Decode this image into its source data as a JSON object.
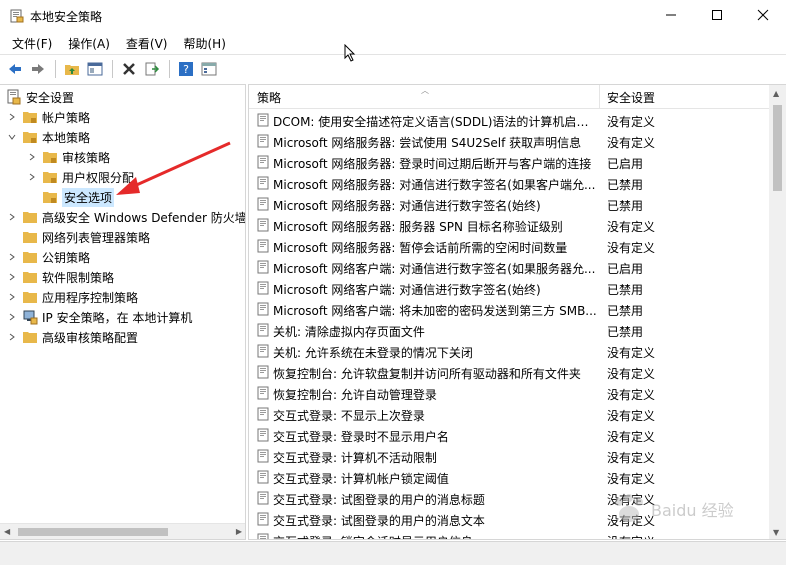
{
  "window": {
    "title": "本地安全策略"
  },
  "menu": [
    {
      "label": "文件",
      "key": "(F)"
    },
    {
      "label": "操作",
      "key": "(A)"
    },
    {
      "label": "查看",
      "key": "(V)"
    },
    {
      "label": "帮助",
      "key": "(H)"
    }
  ],
  "tree": {
    "root": "安全设置",
    "items": [
      {
        "label": "帐户策略"
      },
      {
        "label": "本地策略"
      },
      {
        "label": "审核策略"
      },
      {
        "label": "用户权限分配"
      },
      {
        "label": "安全选项"
      },
      {
        "label": "高级安全 Windows Defender 防火墙"
      },
      {
        "label": "网络列表管理器策略"
      },
      {
        "label": "公钥策略"
      },
      {
        "label": "软件限制策略"
      },
      {
        "label": "应用程序控制策略"
      },
      {
        "label": "IP 安全策略，在 本地计算机"
      },
      {
        "label": "高级审核策略配置"
      }
    ]
  },
  "list": {
    "columns": {
      "policy": "策略",
      "setting": "安全设置"
    },
    "rows": [
      {
        "policy": "DCOM: 使用安全描述符定义语言(SDDL)语法的计算机启动...",
        "setting": "没有定义"
      },
      {
        "policy": "Microsoft 网络服务器: 尝试使用 S4U2Self 获取声明信息",
        "setting": "没有定义"
      },
      {
        "policy": "Microsoft 网络服务器: 登录时间过期后断开与客户端的连接",
        "setting": "已启用"
      },
      {
        "policy": "Microsoft 网络服务器: 对通信进行数字签名(如果客户端允...",
        "setting": "已禁用"
      },
      {
        "policy": "Microsoft 网络服务器: 对通信进行数字签名(始终)",
        "setting": "已禁用"
      },
      {
        "policy": "Microsoft 网络服务器: 服务器 SPN 目标名称验证级别",
        "setting": "没有定义"
      },
      {
        "policy": "Microsoft 网络服务器: 暂停会话前所需的空闲时间数量",
        "setting": "没有定义"
      },
      {
        "policy": "Microsoft 网络客户端: 对通信进行数字签名(如果服务器允...",
        "setting": "已启用"
      },
      {
        "policy": "Microsoft 网络客户端: 对通信进行数字签名(始终)",
        "setting": "已禁用"
      },
      {
        "policy": "Microsoft 网络客户端: 将未加密的密码发送到第三方 SMB...",
        "setting": "已禁用"
      },
      {
        "policy": "关机: 清除虚拟内存页面文件",
        "setting": "已禁用"
      },
      {
        "policy": "关机: 允许系统在未登录的情况下关闭",
        "setting": "没有定义"
      },
      {
        "policy": "恢复控制台: 允许软盘复制并访问所有驱动器和所有文件夹",
        "setting": "没有定义"
      },
      {
        "policy": "恢复控制台: 允许自动管理登录",
        "setting": "没有定义"
      },
      {
        "policy": "交互式登录: 不显示上次登录",
        "setting": "没有定义"
      },
      {
        "policy": "交互式登录: 登录时不显示用户名",
        "setting": "没有定义"
      },
      {
        "policy": "交互式登录: 计算机不活动限制",
        "setting": "没有定义"
      },
      {
        "policy": "交互式登录: 计算机帐户锁定阈值",
        "setting": "没有定义"
      },
      {
        "policy": "交互式登录: 试图登录的用户的消息标题",
        "setting": "没有定义"
      },
      {
        "policy": "交互式登录: 试图登录的用户的消息文本",
        "setting": "没有定义"
      },
      {
        "policy": "交互式登录: 锁定会话时显示用户信息",
        "setting": "没有定义"
      }
    ]
  },
  "watermark": "Baidu 经验",
  "colors": {
    "selection": "#cce8ff",
    "folder": "#e8b84a",
    "arrow": "#e52a2a",
    "nav_blue": "#2b6fc4"
  }
}
